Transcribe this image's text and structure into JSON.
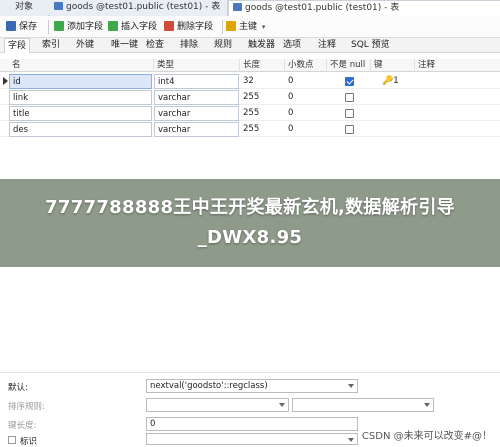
{
  "tabs": {
    "objects": "对象",
    "tab1": "goods @test01.public (test01) - 表",
    "tab2": "goods @test01.public (test01) - 表"
  },
  "toolbar": {
    "save": "保存",
    "add_field": "添加字段",
    "insert_field": "插入字段",
    "delete_field": "删除字段",
    "primary_key": "主键"
  },
  "subtabs": [
    "字段",
    "索引",
    "外键",
    "唯一键",
    "检查",
    "排除",
    "规则",
    "触发器",
    "选项",
    "注释",
    "SQL 预览"
  ],
  "columns": {
    "name": "名",
    "type": "类型",
    "length": "长度",
    "scale": "小数点",
    "not_null": "不是 null",
    "key": "键",
    "comment": "注释"
  },
  "rows": [
    {
      "name": "id",
      "type": "int4",
      "length": "32",
      "scale": "0",
      "not_null": true,
      "key": "1"
    },
    {
      "name": "link",
      "type": "varchar",
      "length": "255",
      "scale": "0",
      "not_null": false,
      "key": ""
    },
    {
      "name": "title",
      "type": "varchar",
      "length": "255",
      "scale": "0",
      "not_null": false,
      "key": ""
    },
    {
      "name": "des",
      "type": "varchar",
      "length": "255",
      "scale": "0",
      "not_null": false,
      "key": ""
    }
  ],
  "overlay": {
    "text": "7777788888王中王开奖最新玄机,数据解析引导_DWX8.95"
  },
  "properties": {
    "default_label": "默认:",
    "default_value": "nextval('goodsto'::regclass)",
    "collation_label": "排序规则:",
    "key_length_label": "键长度:",
    "key_length_value": "0",
    "identity_label": "标识"
  },
  "watermark": "CSDN @未来可以改变#@！",
  "colors": {
    "accent": "#2f6fd1",
    "key_icon": "#c58b00",
    "overlay": "#6e7d69"
  }
}
